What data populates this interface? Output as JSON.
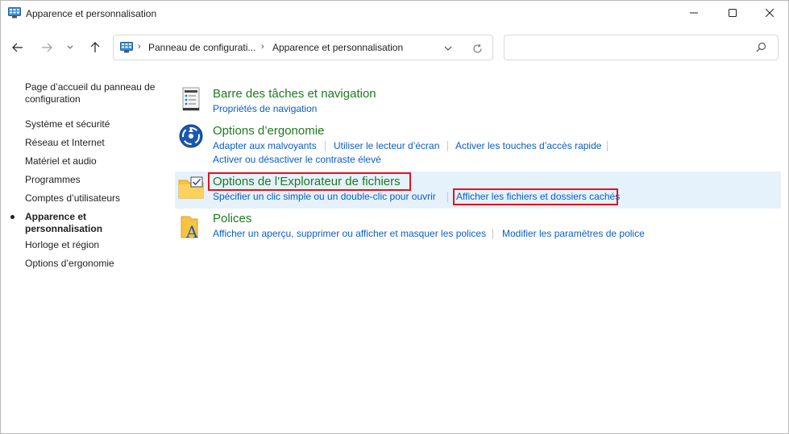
{
  "window": {
    "title": "Apparence et personnalisation",
    "app_icon": "control-panel-icon",
    "controls": [
      "minimize-icon",
      "maximize-icon",
      "close-icon"
    ]
  },
  "nav": {
    "back_icon": "arrow-left-icon",
    "forward_icon": "arrow-right-icon",
    "recent_icon": "chevron-down-icon",
    "up_icon": "arrow-up-icon"
  },
  "address": {
    "icon": "control-panel-icon",
    "crumbs": [
      "Panneau de configurati...",
      "Apparence et personnalisation"
    ],
    "dropdown_icon": "chevron-down-icon",
    "refresh_icon": "refresh-icon"
  },
  "search": {
    "value": "",
    "placeholder": "",
    "icon": "search-icon"
  },
  "sidebar": {
    "items": [
      {
        "label": "Page d’accueil du panneau de configuration"
      },
      {
        "label": "Système et sécurité"
      },
      {
        "label": "Réseau et Internet"
      },
      {
        "label": "Matériel et audio"
      },
      {
        "label": "Programmes"
      },
      {
        "label": "Comptes d’utilisateurs"
      },
      {
        "label": "Apparence et personnalisation",
        "current": true
      },
      {
        "label": "Horloge et région"
      },
      {
        "label": "Options d’ergonomie"
      }
    ]
  },
  "categories": [
    {
      "title": "Barre des tâches et navigation",
      "icon": "taskbar-icon",
      "tasks": [
        "Propriétés de navigation"
      ]
    },
    {
      "title": "Options d’ergonomie",
      "icon": "ease-of-access-icon",
      "tasks": [
        "Adapter aux malvoyants",
        "Utiliser le lecteur d’écran",
        "Activer les touches d’accès rapide",
        "Activer ou désactiver le contraste élevé"
      ]
    },
    {
      "title": "Options de l’Explorateur de fichiers",
      "icon": "folder-options-icon",
      "tasks": [
        "Spécifier un clic simple ou un double-clic pour ouvrir",
        "Afficher les fichiers et dossiers cachés"
      ],
      "highlighted": true
    },
    {
      "title": "Polices",
      "icon": "fonts-icon",
      "tasks": [
        "Afficher un aperçu, supprimer ou afficher et masquer les polices",
        "Modifier les paramètres de police"
      ]
    }
  ],
  "colors": {
    "category_title": "#1e7b1e",
    "link": "#0a5ec7",
    "highlight_bg": "#e5f1fb",
    "annotation_box": "#e0141e"
  }
}
